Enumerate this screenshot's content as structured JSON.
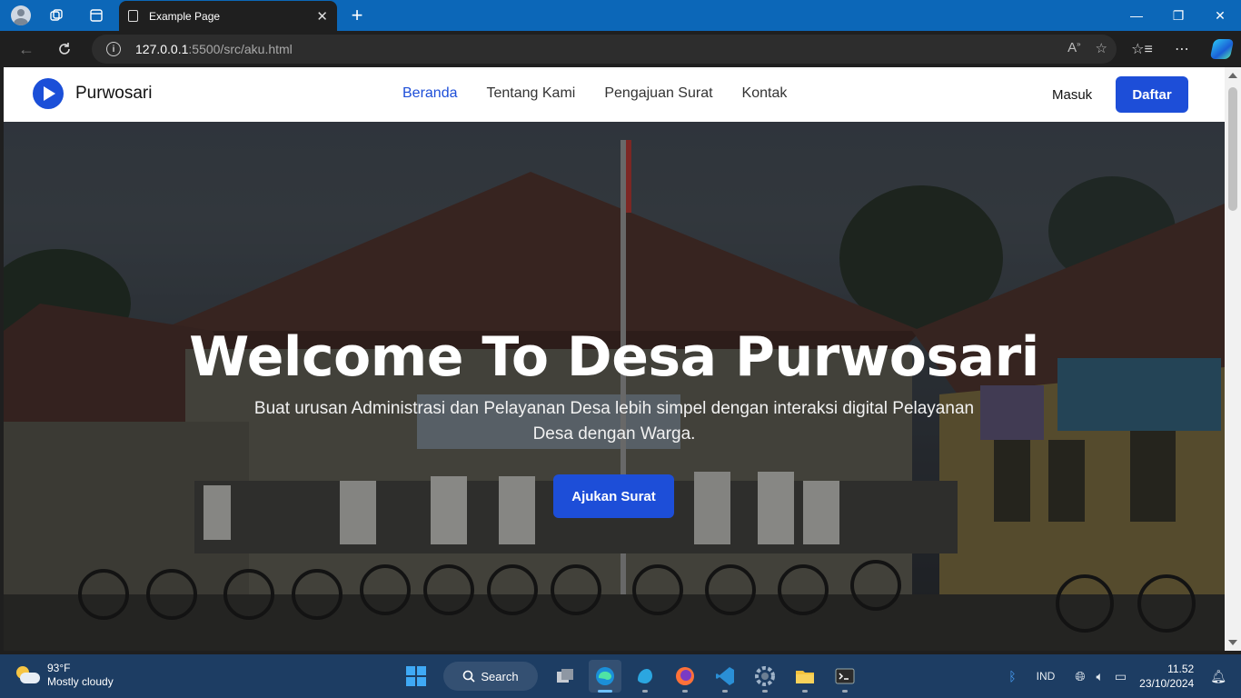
{
  "browser": {
    "tab_title": "Example Page",
    "url_host": "127.0.0.1",
    "url_path": ":5500/src/aku.html"
  },
  "site": {
    "brand": "Purwosari",
    "menu": [
      "Beranda",
      "Tentang Kami",
      "Pengajuan Surat",
      "Kontak"
    ],
    "active_menu": "Beranda",
    "login": "Masuk",
    "register": "Daftar",
    "accent_color": "#1d4ed8"
  },
  "hero": {
    "title": "Welcome To Desa Purwosari",
    "subtitle": "Buat urusan Administrasi dan Pelayanan Desa lebih simpel dengan interaksi digital Pelayanan Desa dengan Warga.",
    "cta": "Ajukan Surat"
  },
  "taskbar": {
    "weather_temp": "93°F",
    "weather_desc": "Mostly cloudy",
    "search_label": "Search",
    "language": "IND",
    "time": "11.52",
    "date": "23/10/2024",
    "apps": [
      "file-explorer-multitask-icon",
      "edge-icon",
      "app-store-icon",
      "firefox-icon",
      "vscode-icon",
      "settings-icon",
      "folder-icon",
      "terminal-icon"
    ]
  }
}
